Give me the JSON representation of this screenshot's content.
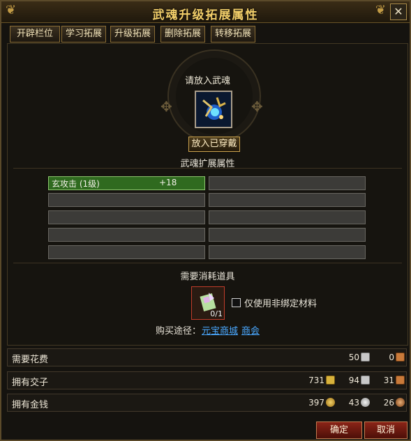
{
  "window": {
    "title": "武魂升级拓展属性",
    "close_label": "✕"
  },
  "tabs": [
    "开辟栏位",
    "学习拓展",
    "升级拓展",
    "删除拓展",
    "转移拓展"
  ],
  "soul": {
    "prompt": "请放入武魂",
    "put_worn_label": "放入已穿戴",
    "section_title": "武魂扩展属性"
  },
  "attributes": [
    {
      "name": "玄攻击 (1级)",
      "value": "+18",
      "active": true
    }
  ],
  "materials": {
    "title": "需要消耗道具",
    "count": "0/1",
    "checkbox_label": "仅使用非绑定材料",
    "buy_label": "购买途径：",
    "links": [
      "元宝商城",
      "商会"
    ]
  },
  "rows": {
    "cost": {
      "label": "需要花费",
      "v1": "50",
      "v2": "0"
    },
    "owned_jiaozi": {
      "label": "拥有交子",
      "v1": "731",
      "v2": "94",
      "v3": "31"
    },
    "owned_money": {
      "label": "拥有金钱",
      "v1": "397",
      "v2": "43",
      "v3": "26"
    }
  },
  "buttons": {
    "confirm": "确定",
    "cancel": "取消"
  },
  "colors": {
    "title": "#f3cf6a",
    "active_cell": "#2f6a1f",
    "link": "#4aa8ff",
    "button": "#8a2417"
  }
}
